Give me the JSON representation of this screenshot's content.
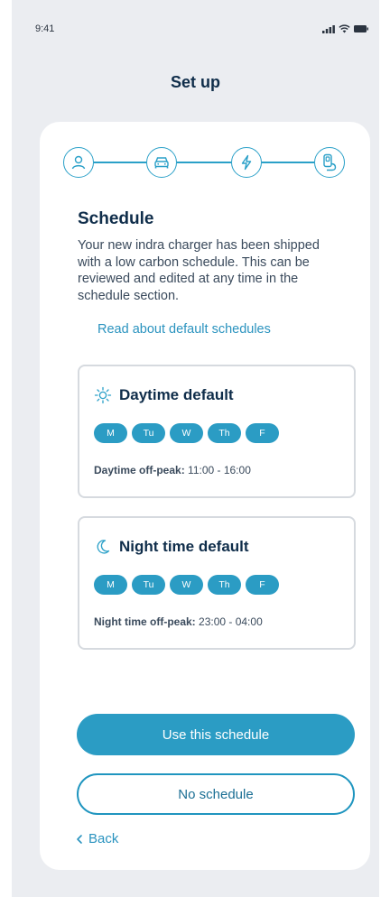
{
  "status_bar": {
    "time": "9:41"
  },
  "header": {
    "title": "Set up"
  },
  "stepper": {
    "steps": [
      {
        "icon": "user-icon"
      },
      {
        "icon": "car-icon"
      },
      {
        "icon": "lightning-icon"
      },
      {
        "icon": "charger-icon"
      }
    ]
  },
  "schedule": {
    "title": "Schedule",
    "intro": "Your new indra charger has been shipped with a low carbon schedule. This can be reviewed and edited at any time in the schedule section.",
    "link": "Read about default schedules"
  },
  "daytime": {
    "title": "Daytime default",
    "icon": "sun-icon",
    "days": [
      "M",
      "Tu",
      "W",
      "Th",
      "F"
    ],
    "offpeak_label": "Daytime off-peak:",
    "offpeak_value": "11:00 - 16:00"
  },
  "nighttime": {
    "title": "Night time default",
    "icon": "moon-icon",
    "days": [
      "M",
      "Tu",
      "W",
      "Th",
      "F"
    ],
    "offpeak_label": "Night time off-peak:",
    "offpeak_value": "23:00 - 04:00"
  },
  "actions": {
    "primary": "Use this schedule",
    "secondary": "No schedule",
    "back": "Back"
  },
  "colors": {
    "accent": "#2b9cc4",
    "title": "#0f2d4a",
    "background": "#ebedf1"
  }
}
